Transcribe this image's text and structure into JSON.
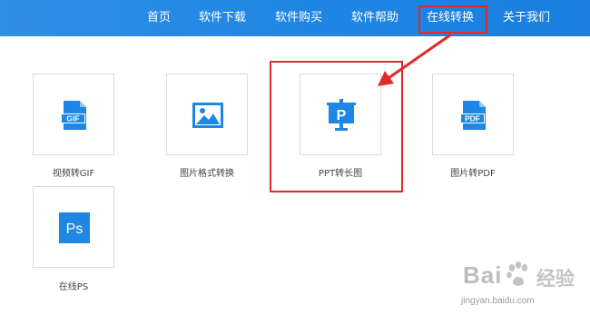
{
  "nav": {
    "items": [
      {
        "label": "首页"
      },
      {
        "label": "软件下载"
      },
      {
        "label": "软件购买"
      },
      {
        "label": "软件帮助"
      },
      {
        "label": "在线转换"
      },
      {
        "label": "关于我们"
      }
    ],
    "active_index": 4
  },
  "tools": [
    {
      "label": "视频转GIF",
      "icon": "gif-file-icon",
      "icon_text": "GIF"
    },
    {
      "label": "图片格式转换",
      "icon": "image-icon"
    },
    {
      "label": "PPT转长图",
      "icon": "ppt-presentation-icon",
      "icon_text": "P"
    },
    {
      "label": "图片转PDF",
      "icon": "pdf-file-icon",
      "icon_text": "PDF"
    },
    {
      "label": "在线PS",
      "icon": "photoshop-icon",
      "icon_text": "Ps"
    }
  ],
  "watermark": {
    "brand": "Bai",
    "brand_cn": "经验",
    "url": "jingyan.baidu.com"
  },
  "colors": {
    "nav_bg": "#1e86e3",
    "icon_blue": "#1e86e3",
    "highlight_red": "#e12b2b"
  }
}
